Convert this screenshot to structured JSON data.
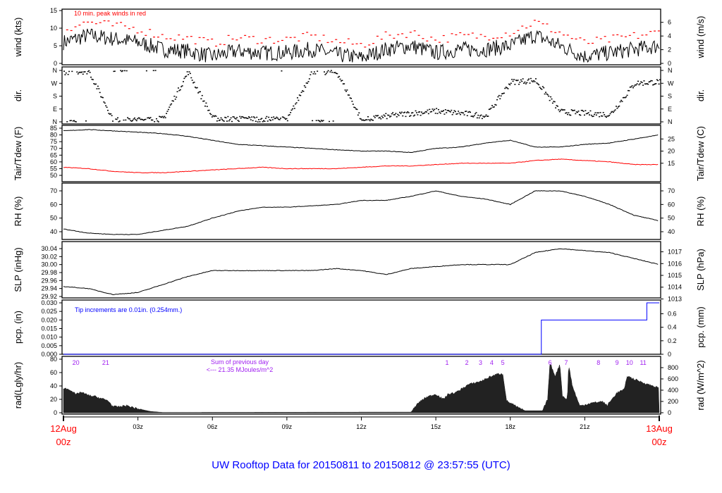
{
  "title": "UW Rooftop Data for 20150811  to  20150812 @ 23:57:55  (UTC)",
  "chart_data": {
    "type": "line",
    "x_unit": "hour UTC",
    "x_ticks": [
      {
        "h": 3,
        "label": "03z"
      },
      {
        "h": 6,
        "label": "06z"
      },
      {
        "h": 9,
        "label": "09z"
      },
      {
        "h": 12,
        "label": "12z"
      },
      {
        "h": 15,
        "label": "15z"
      },
      {
        "h": 18,
        "label": "18z"
      },
      {
        "h": 21,
        "label": "21z"
      }
    ],
    "start_label": {
      "date": "12Aug",
      "time": "00z"
    },
    "end_label": {
      "date": "13Aug",
      "time": "00z"
    },
    "panels": [
      {
        "id": "wind",
        "ylabel": "wind (kts)",
        "ylabel_right": "wind (m/s)",
        "ylim": [
          0,
          15
        ],
        "ticks": [
          0,
          5,
          10,
          15
        ],
        "ylim_right": [
          0,
          7.72
        ],
        "ticks_right": [
          0,
          2,
          4,
          6
        ],
        "annotation": "10 min. peak winds in red",
        "series": [
          {
            "name": "wind",
            "color": "#000000",
            "hourly": [
              6,
              8,
              7,
              6,
              4,
              3.5,
              2,
              3.5,
              3,
              3,
              4,
              2.5,
              1.5,
              4,
              5,
              3,
              4,
              4,
              5,
              8,
              5,
              2,
              3,
              4,
              5
            ]
          },
          {
            "name": "peak",
            "color": "#ff0000",
            "style": "dash",
            "offset_kts": 3
          }
        ]
      },
      {
        "id": "dir",
        "ylabel": "dir.",
        "ylabel_right": "dir.",
        "ylim": [
          0,
          360
        ],
        "tick_labels": [
          "N",
          "E",
          "S",
          "W",
          "N"
        ],
        "series": [
          {
            "name": "direction_deg",
            "color": "#000000",
            "hourly": [
              350,
              355,
              10,
              15,
              20,
              350,
              25,
              20,
              20,
              15,
              355,
              345,
              10,
              40,
              60,
              75,
              60,
              40,
              280,
              290,
              70,
              60,
              50,
              270,
              280
            ]
          }
        ]
      },
      {
        "id": "temp",
        "ylabel": "Tair/Tdew (F)",
        "ylabel_right": "Tair/Tdew (C)",
        "ylim": [
          49.5,
          86.5
        ],
        "ticks": [
          50,
          55,
          60,
          65,
          70,
          75,
          80,
          85
        ],
        "ticks_right": [
          15,
          20,
          25
        ],
        "series": [
          {
            "name": "Tair",
            "color": "#000000",
            "hourly": [
              83,
              84,
              83,
              82,
              81,
              79,
              76,
              73,
              72,
              71,
              70,
              69,
              68,
              68,
              67,
              70,
              71,
              74,
              76,
              71,
              71,
              73,
              74,
              77,
              80
            ]
          },
          {
            "name": "Tdew",
            "color": "#ff0000",
            "hourly": [
              56,
              55,
              53,
              52,
              52,
              53,
              54,
              55,
              56,
              55,
              55,
              55,
              56,
              57,
              57,
              58,
              59,
              59,
              59,
              61,
              62,
              61,
              60,
              58,
              58
            ]
          }
        ]
      },
      {
        "id": "rh",
        "ylabel": "RH (%)",
        "ylabel_right": "RH (%)",
        "ylim": [
          35,
          75
        ],
        "ticks": [
          40,
          50,
          60,
          70
        ],
        "ticks_right": [
          40,
          50,
          60,
          70
        ],
        "series": [
          {
            "name": "RH",
            "color": "#000000",
            "hourly": [
              42,
              39,
              38,
              38,
              41,
              44,
              50,
              55,
              58,
              58,
              59,
              60,
              63,
              63,
              66,
              70,
              66,
              64,
              60,
              70,
              70,
              66,
              60,
              52,
              48
            ]
          }
        ]
      },
      {
        "id": "slp",
        "ylabel": "SLP (inHg)",
        "ylabel_right": "SLP (hPa)",
        "ylim": [
          29.915,
          30.05
        ],
        "ticks": [
          29.92,
          29.94,
          29.96,
          29.98,
          30.0,
          30.02,
          30.04
        ],
        "ticks_right": [
          1013,
          1014,
          1015,
          1016,
          1017
        ],
        "series": [
          {
            "name": "SLP",
            "color": "#000000",
            "hourly": [
              29.945,
              29.94,
              29.925,
              29.93,
              29.95,
              29.97,
              29.985,
              29.985,
              29.985,
              29.985,
              29.985,
              29.99,
              29.985,
              29.975,
              29.99,
              29.995,
              30.0,
              30.0,
              30.0,
              30.03,
              30.04,
              30.035,
              30.03,
              30.015,
              30.0
            ]
          }
        ]
      },
      {
        "id": "pcp",
        "ylabel": "pcp. (in)",
        "ylabel_right": "pcp. (mm)",
        "ylim": [
          0,
          0.03
        ],
        "ticks": [
          "0.000",
          "0.005",
          "0.010",
          "0.015",
          "0.020",
          "0.025",
          "0.030"
        ],
        "ticks_right": [
          0,
          0.2,
          0.4,
          0.6
        ],
        "annotation": "Tip increments are 0.01in. (0.254mm.)",
        "series": [
          {
            "name": "cumulative_precip",
            "color": "#0000ff",
            "steps": [
              [
                0,
                0
              ],
              [
                19.25,
                0.02
              ],
              [
                23.5,
                0.03
              ],
              [
                24,
                0.03
              ]
            ]
          }
        ]
      },
      {
        "id": "rad",
        "ylabel": "rad(Lgly/hr)",
        "ylabel_right": "rad (W/m^2)",
        "ylim": [
          0,
          80
        ],
        "ticks": [
          0,
          20,
          40,
          60,
          80
        ],
        "ticks_right": [
          0,
          200,
          400,
          600,
          800
        ],
        "annotation_lines": [
          "Sum of previous day",
          "<--- 21.35 MJoules/m^2"
        ],
        "sun_labels": [
          {
            "h": 0.5,
            "label": "20"
          },
          {
            "h": 1.7,
            "label": "21"
          },
          {
            "h": 15.45,
            "label": "1"
          },
          {
            "h": 16.25,
            "label": "2"
          },
          {
            "h": 16.8,
            "label": "3"
          },
          {
            "h": 17.25,
            "label": "4"
          },
          {
            "h": 17.7,
            "label": "5"
          },
          {
            "h": 19.6,
            "label": "6"
          },
          {
            "h": 20.25,
            "label": "7"
          },
          {
            "h": 21.55,
            "label": "8"
          },
          {
            "h": 22.3,
            "label": "9"
          },
          {
            "h": 22.8,
            "label": "10"
          },
          {
            "h": 23.35,
            "label": "11"
          }
        ],
        "series": [
          {
            "name": "radiation",
            "color": "#222222",
            "points": [
              [
                0,
                37
              ],
              [
                0.3,
                34
              ],
              [
                0.5,
                27
              ],
              [
                0.7,
                31
              ],
              [
                1,
                26
              ],
              [
                1.3,
                24
              ],
              [
                1.8,
                18
              ],
              [
                2,
                9
              ],
              [
                2.3,
                9
              ],
              [
                2.5,
                11
              ],
              [
                3,
                6
              ],
              [
                3.5,
                2
              ],
              [
                4,
                0.5
              ],
              [
                14,
                1
              ],
              [
                14.3,
                15
              ],
              [
                14.6,
                23
              ],
              [
                15,
                28
              ],
              [
                15.3,
                20
              ],
              [
                15.5,
                28
              ],
              [
                15.8,
                30
              ],
              [
                16.3,
                42
              ],
              [
                16.8,
                47
              ],
              [
                17.2,
                54
              ],
              [
                17.5,
                58
              ],
              [
                17.7,
                58
              ],
              [
                17.85,
                18
              ],
              [
                18.3,
                8
              ],
              [
                18.6,
                3
              ],
              [
                19.3,
                3
              ],
              [
                19.5,
                20
              ],
              [
                19.6,
                75
              ],
              [
                19.8,
                55
              ],
              [
                20.0,
                72
              ],
              [
                20.1,
                25
              ],
              [
                20.3,
                20
              ],
              [
                20.35,
                72
              ],
              [
                20.5,
                40
              ],
              [
                20.8,
                10
              ],
              [
                21.2,
                14
              ],
              [
                21.7,
                17
              ],
              [
                21.9,
                11
              ],
              [
                22.3,
                30
              ],
              [
                22.6,
                35
              ],
              [
                22.7,
                55
              ],
              [
                23.0,
                50
              ],
              [
                23.5,
                43
              ],
              [
                24,
                37
              ]
            ]
          }
        ]
      }
    ]
  }
}
